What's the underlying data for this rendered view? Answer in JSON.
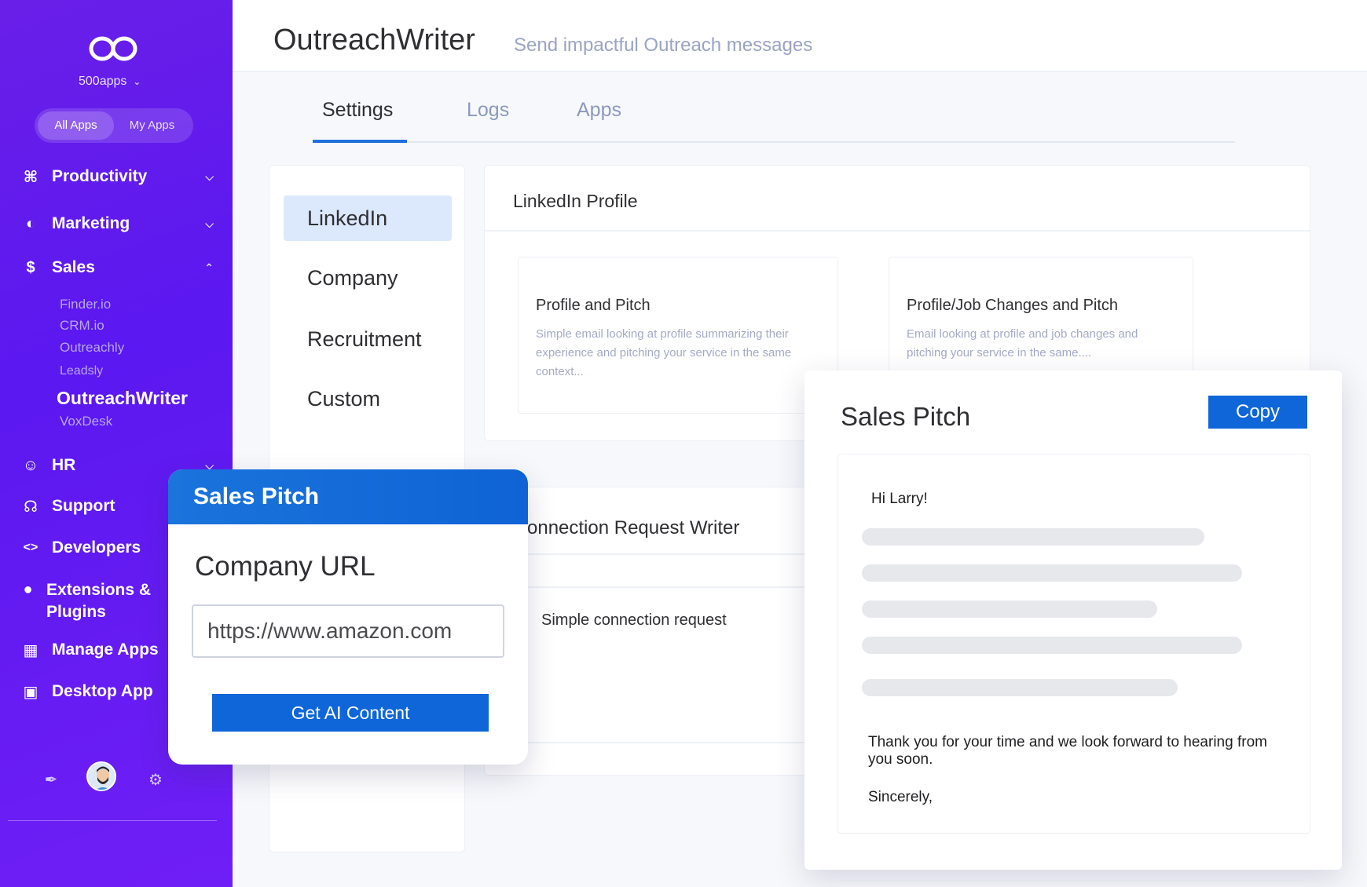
{
  "sidebar": {
    "org_name": "500apps",
    "toggle": [
      "All Apps",
      "My Apps"
    ],
    "nav": [
      {
        "label": "Productivity",
        "icon": "command-icon"
      },
      {
        "label": "Marketing",
        "icon": "globe-icon"
      },
      {
        "label": "Sales",
        "icon": "dollar-icon"
      },
      {
        "label": "HR",
        "icon": "user-icon"
      },
      {
        "label": "Support",
        "icon": "headset-icon"
      },
      {
        "label": "Developers",
        "icon": "code-icon"
      },
      {
        "label": "Extensions & Plugins",
        "icon": "puzzle-icon"
      },
      {
        "label": "Manage Apps",
        "icon": "grid-icon"
      },
      {
        "label": "Desktop App",
        "icon": "monitor-icon"
      }
    ],
    "sales_sub": [
      "Finder.io",
      "CRM.io",
      "Outreachly",
      "Leadsly",
      "OutreachWriter",
      "VoxDesk"
    ]
  },
  "header": {
    "title": "OutreachWriter",
    "subtitle": "Send impactful Outreach messages"
  },
  "tabs": [
    "Settings",
    "Logs",
    "Apps"
  ],
  "categories": [
    "LinkedIn",
    "Company",
    "Recruitment",
    "Custom"
  ],
  "card": {
    "title": "LinkedIn Profile",
    "templates": [
      {
        "title": "Profile and Pitch",
        "desc": "Simple email looking at profile summarizing their experience and pitching your service in the same context..."
      },
      {
        "title": "Profile/Job Changes and Pitch",
        "desc": "Email looking at profile and job changes and pitching your service in the same...."
      }
    ]
  },
  "connection": {
    "title": "onnection Request Writer",
    "desc": "Simple connection request"
  },
  "form": {
    "title": "Sales Pitch",
    "label": "Company URL",
    "url": "https://www.amazon.com",
    "button": "Get AI Content"
  },
  "pitch": {
    "title": "Sales Pitch",
    "copy": "Copy",
    "greeting": "Hi Larry!",
    "thanks": "Thank you for your time and we look forward to hearing from you soon.",
    "sign": "Sincerely,"
  },
  "colors": {
    "sidebar": "#5b18f0",
    "accent": "#0f66d9",
    "active_category": "#dce8fb"
  }
}
